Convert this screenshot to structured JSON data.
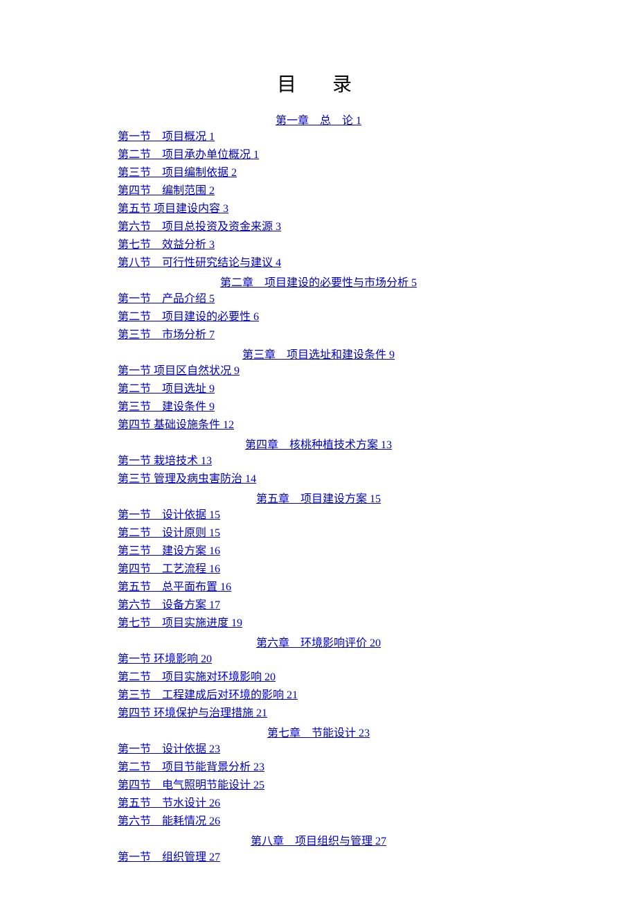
{
  "title": "目　录",
  "toc": [
    {
      "type": "chapter",
      "text": "第一章　总　论 1"
    },
    {
      "type": "section",
      "text": "第一节　项目概况 1"
    },
    {
      "type": "section",
      "text": "第二节　项目承办单位概况 1"
    },
    {
      "type": "section",
      "text": "第三节　项目编制依据 2"
    },
    {
      "type": "section",
      "text": "第四节　编制范围 2"
    },
    {
      "type": "section",
      "text": "第五节 项目建设内容 3"
    },
    {
      "type": "section",
      "text": "第六节　项目总投资及资金来源 3"
    },
    {
      "type": "section",
      "text": "第七节　效益分析 3"
    },
    {
      "type": "section",
      "text": "第八节　可行性研究结论与建议 4"
    },
    {
      "type": "chapter",
      "text": "第二章　项目建设的必要性与市场分析 5"
    },
    {
      "type": "section",
      "text": "第一节　产品介绍 5"
    },
    {
      "type": "section",
      "text": "第二节　项目建设的必要性 6"
    },
    {
      "type": "section",
      "text": "第三节　市场分析 7"
    },
    {
      "type": "chapter",
      "text": "第三章　项目选址和建设条件 9"
    },
    {
      "type": "section",
      "text": "第一节 项目区自然状况 9"
    },
    {
      "type": "section",
      "text": "第二节　项目选址 9"
    },
    {
      "type": "section",
      "text": "第三节　建设条件 9"
    },
    {
      "type": "section",
      "text": "第四节 基础设施条件 12"
    },
    {
      "type": "chapter",
      "text": "第四章　核桃种植技术方案 13"
    },
    {
      "type": "section",
      "text": "第一节 栽培技术 13"
    },
    {
      "type": "section",
      "text": "第三节 管理及病虫害防治 14"
    },
    {
      "type": "chapter",
      "text": "第五章　项目建设方案 15"
    },
    {
      "type": "section",
      "text": "第一节　设计依据 15"
    },
    {
      "type": "section",
      "text": "第二节　设计原则 15"
    },
    {
      "type": "section",
      "text": "第三节　建设方案 16"
    },
    {
      "type": "section",
      "text": "第四节　工艺流程 16"
    },
    {
      "type": "section",
      "text": "第五节　总平面布置 16"
    },
    {
      "type": "section",
      "text": "第六节　设备方案 17"
    },
    {
      "type": "section",
      "text": "第七节　项目实施进度 19"
    },
    {
      "type": "chapter",
      "text": "第六章　环境影响评价 20"
    },
    {
      "type": "section",
      "text": "第一节 环境影响 20"
    },
    {
      "type": "section",
      "text": "第二节　项目实施对环境影响 20"
    },
    {
      "type": "section",
      "text": "第三节　工程建成后对环境的影响 21"
    },
    {
      "type": "section",
      "text": "第四节 环境保护与治理措施 21"
    },
    {
      "type": "chapter",
      "text": "第七章　节能设计 23"
    },
    {
      "type": "section",
      "text": "第一节　设计依据 23"
    },
    {
      "type": "section",
      "text": "第二节　项目节能背景分析 23"
    },
    {
      "type": "section",
      "text": "第四节　电气照明节能设计 25"
    },
    {
      "type": "section",
      "text": "第五节　节水设计 26"
    },
    {
      "type": "section",
      "text": "第六节　能耗情况 26"
    },
    {
      "type": "chapter",
      "text": "第八章　项目组织与管理 27"
    },
    {
      "type": "section",
      "text": "第一节　组织管理 27"
    }
  ]
}
